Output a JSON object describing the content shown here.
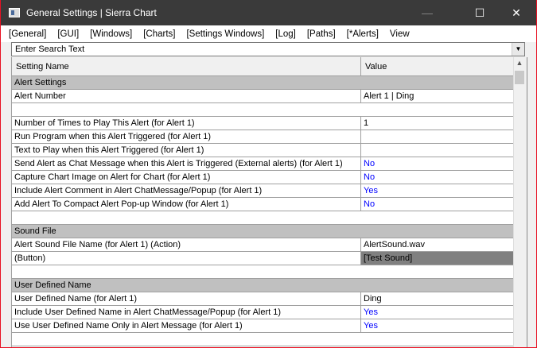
{
  "window": {
    "title": "General Settings | Sierra Chart",
    "minimize": "—",
    "maximize": "☐",
    "close": "✕"
  },
  "menu": [
    "[General]",
    "[GUI]",
    "[Windows]",
    "[Charts]",
    "[Settings Windows]",
    "[Log]",
    "[Paths]",
    "[*Alerts]",
    "View"
  ],
  "search": {
    "placeholder": "Enter Search Text",
    "dropdown": "▼"
  },
  "columns": {
    "name": "Setting Name",
    "value": "Value"
  },
  "scroll_up": "▲",
  "rows": [
    {
      "type": "sec",
      "name": "Alert Settings"
    },
    {
      "name": "Alert Number",
      "value": "Alert 1 | Ding"
    },
    {
      "type": "blank"
    },
    {
      "name": "Number of Times to Play This Alert (for Alert 1)",
      "value": "1"
    },
    {
      "name": "Run Program when this Alert Triggered (for Alert 1)",
      "value": ""
    },
    {
      "name": "Text to Play when this Alert Triggered (for Alert 1)",
      "value": ""
    },
    {
      "name": "Send Alert as Chat Message when this Alert is Triggered (External alerts) (for Alert 1)",
      "value": "No",
      "blue": true
    },
    {
      "name": "Capture Chart Image on Alert for Chart (for Alert 1)",
      "value": "No",
      "blue": true
    },
    {
      "name": "Include Alert Comment in Alert ChatMessage/Popup (for Alert 1)",
      "value": "Yes",
      "blue": true
    },
    {
      "name": "Add Alert To Compact Alert Pop-up Window (for Alert 1)",
      "value": "No",
      "blue": true
    },
    {
      "type": "blank"
    },
    {
      "type": "sec",
      "name": "Sound File"
    },
    {
      "name": "Alert Sound File Name (for Alert 1) (Action)",
      "value": "AlertSound.wav"
    },
    {
      "name": " (Button)",
      "value": "[Test Sound]",
      "button": true
    },
    {
      "type": "blank"
    },
    {
      "type": "sec",
      "name": "User Defined Name"
    },
    {
      "name": "User Defined Name (for Alert 1)",
      "value": "Ding"
    },
    {
      "name": "Include User Defined Name in Alert ChatMessage/Popup (for Alert 1)",
      "value": "Yes",
      "blue": true
    },
    {
      "name": "Use User Defined Name Only in Alert Message (for Alert 1)",
      "value": "Yes",
      "blue": true
    },
    {
      "type": "blank"
    }
  ]
}
